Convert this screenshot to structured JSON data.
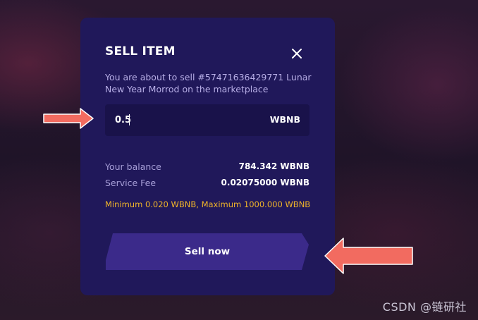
{
  "modal": {
    "title": "SELL ITEM",
    "description": "You are about to sell #57471636429771 Lunar New Year Morrod on the marketplace",
    "price_input": {
      "value": "0.5",
      "currency": "WBNB"
    },
    "balance": {
      "label": "Your balance",
      "value": "784.342 WBNB"
    },
    "service_fee": {
      "label": "Service Fee",
      "value": "0.02075000 WBNB"
    },
    "limits_text": "Minimum 0.020 WBNB, Maximum 1000.000 WBNB",
    "sell_button_label": "Sell now"
  },
  "icons": {
    "close": "close-icon",
    "annotation_arrow": "red-arrow-icon"
  },
  "colors": {
    "modal_bg": "#20185a",
    "input_bg": "#19124a",
    "button_bg": "#3b2a8a",
    "accent_warning": "#f0b429",
    "arrow": "#f26b60"
  },
  "watermark": "CSDN @链研社"
}
